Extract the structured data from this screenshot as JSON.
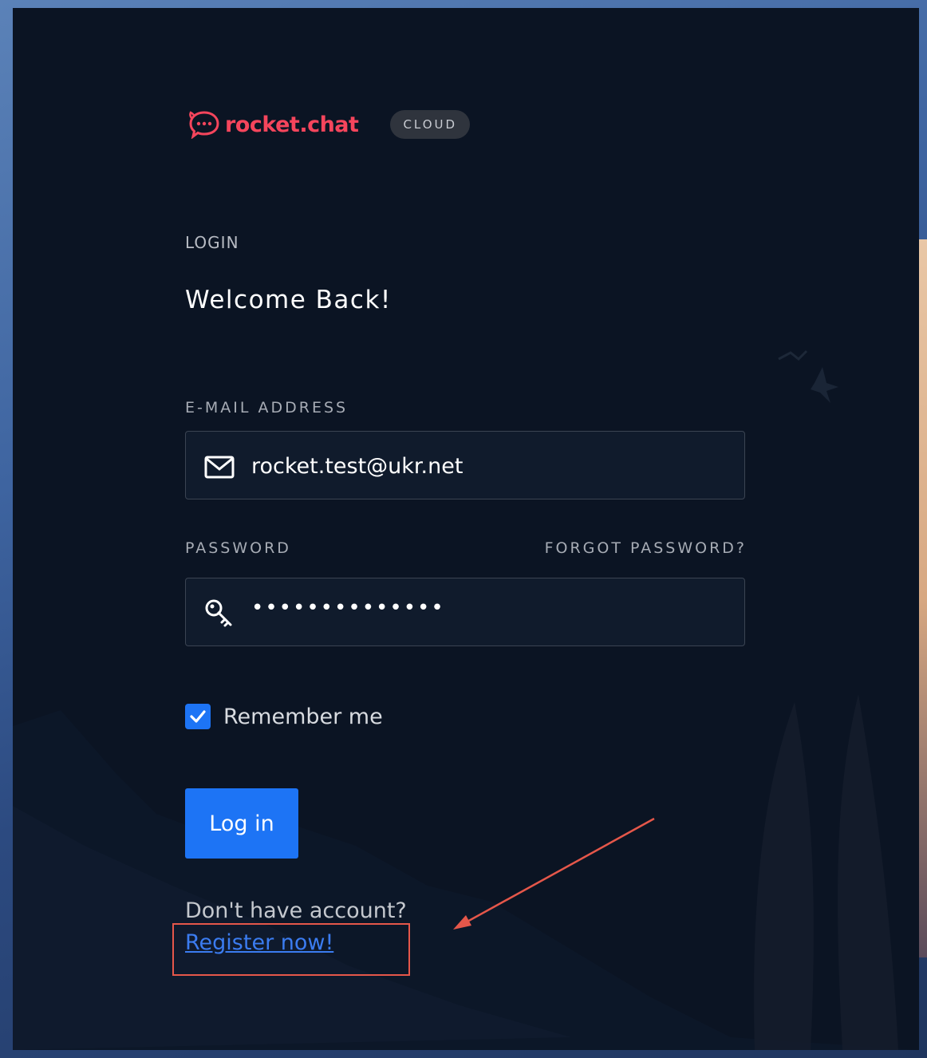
{
  "brand": {
    "logo_icon": "rocket-chat-bubble-icon",
    "name": "rocket.chat",
    "badge": "CLOUD",
    "accent_color": "#f5455c"
  },
  "form": {
    "section_label": "LOGIN",
    "heading": "Welcome Back!",
    "email": {
      "label": "E-MAIL ADDRESS",
      "icon": "mail-icon",
      "value": "rocket.test@ukr.net"
    },
    "password": {
      "label": "PASSWORD",
      "forgot_label": "FORGOT PASSWORD?",
      "icon": "key-icon",
      "masked_value": "••••••••••••••"
    },
    "remember_me": {
      "label": "Remember me",
      "checked": true
    },
    "login_button": "Log in",
    "no_account_text": "Don't have account?",
    "register_link": "Register now!"
  },
  "colors": {
    "panel_bg": "#0b1423",
    "primary": "#1d74f5",
    "annotation": "#e5574a"
  }
}
